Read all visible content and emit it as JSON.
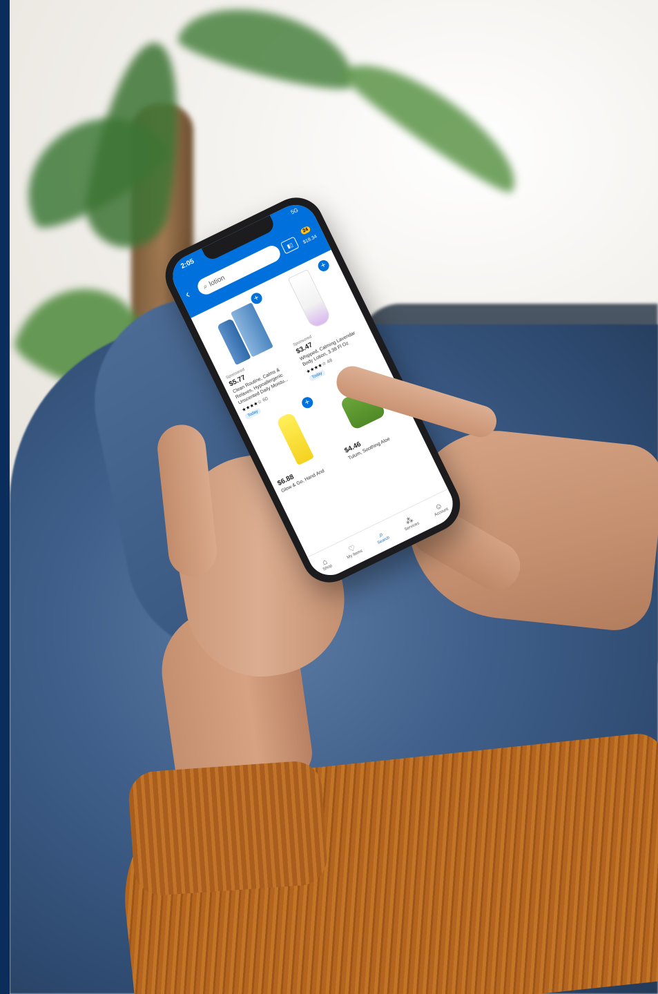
{
  "status": {
    "time": "2:05",
    "signal": "5G"
  },
  "search": {
    "query": "lotion"
  },
  "cart": {
    "count": "24",
    "total": "$18.34"
  },
  "products": [
    {
      "sponsored": "Sponsored",
      "price": "$5.77",
      "name": "Clean Routine, Calms & Relaxes, Hypoallergenic Unscented Daily Moistu...",
      "stars": "★★★★☆",
      "count": "60",
      "badge": "Today"
    },
    {
      "sponsored": "Sponsored",
      "price": "$3.47",
      "name": "Whipped, Calming Lavendar Body Lotion, 3.38 Fl Oz",
      "stars": "★★★★☆",
      "count": "48",
      "badge": "Today"
    },
    {
      "sponsored": "",
      "price": "$6.88",
      "name": "Glow & Go, Hand And",
      "stars": "",
      "count": "",
      "badge": ""
    },
    {
      "sponsored": "",
      "price": "$4.46",
      "name": "Tulum, Soothing Aloe",
      "stars": "",
      "count": "",
      "badge": ""
    }
  ],
  "tabs": [
    {
      "label": "Shop",
      "icon": "shop-icon"
    },
    {
      "label": "My Items",
      "icon": "my-items-icon"
    },
    {
      "label": "Search",
      "icon": "search-icon"
    },
    {
      "label": "Services",
      "icon": "services-icon"
    },
    {
      "label": "Account",
      "icon": "account-icon"
    }
  ],
  "colors": {
    "brand_blue": "#0071dc",
    "cart_badge": "#ffc220",
    "sweater": "#b3651f",
    "border_navy": "#0a2d5c"
  }
}
